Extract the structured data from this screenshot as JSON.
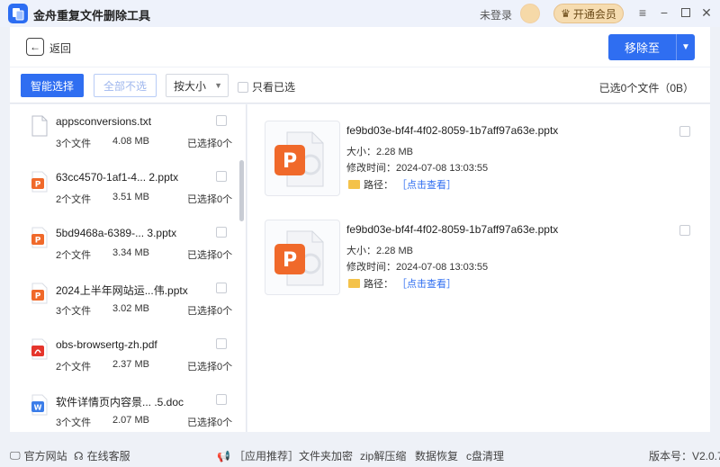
{
  "app": {
    "title": "金舟重复文件删除工具",
    "login_text": "未登录",
    "vip_label": "开通会员"
  },
  "header": {
    "back_label": "返回",
    "move_label": "移除至"
  },
  "toolbar": {
    "smart_select": "智能选择",
    "deselect_all": "全部不选",
    "sort_value": "按大小",
    "only_selected": "只看已选",
    "selected_summary": "已选0个文件（0B）"
  },
  "groups": [
    {
      "name": "appsconversions.txt",
      "count": "3个文件",
      "size": "4.08 MB",
      "selected": "已选择0个",
      "icon": "txt-file-icon"
    },
    {
      "name": "63cc4570-1af1-4... 2.pptx",
      "count": "2个文件",
      "size": "3.51 MB",
      "selected": "已选择0个",
      "icon": "pptx-file-icon"
    },
    {
      "name": "5bd9468a-6389-... 3.pptx",
      "count": "2个文件",
      "size": "3.34 MB",
      "selected": "已选择0个",
      "icon": "pptx-file-icon"
    },
    {
      "name": "2024上半年网站运...伟.pptx",
      "count": "3个文件",
      "size": "3.02 MB",
      "selected": "已选择0个",
      "icon": "pptx-file-icon"
    },
    {
      "name": "obs-browsertg-zh.pdf",
      "count": "2个文件",
      "size": "2.37 MB",
      "selected": "已选择0个",
      "icon": "pdf-file-icon"
    },
    {
      "name": "软件详情页内容景... .5.doc",
      "count": "3个文件",
      "size": "2.07 MB",
      "selected": "已选择0个",
      "icon": "doc-file-icon"
    }
  ],
  "files": [
    {
      "name": "fe9bd03e-bf4f-4f02-8059-1b7aff97a63e.pptx",
      "size": "大小：2.28 MB",
      "mtime": "修改时间：2024-07-08 13:03:55",
      "path_label": "路径：",
      "path_link": "［点击查看］"
    },
    {
      "name": "fe9bd03e-bf4f-4f02-8059-1b7aff97a63e.pptx",
      "size": "大小：2.28 MB",
      "mtime": "修改时间：2024-07-08 13:03:55",
      "path_label": "路径：",
      "path_link": "［点击查看］"
    }
  ],
  "footer": {
    "website": "官方网站",
    "service": "在线客服",
    "recommend": "［应用推荐］",
    "encrypt": "文件夹加密",
    "zip": "zip解压缩",
    "recover": "数据恢复",
    "cclean": "c盘清理",
    "version": "版本号：V2.0.7"
  },
  "colors": {
    "primary": "#2f6ef1",
    "pptx": "#f0692a",
    "pdf": "#e5352c",
    "doc": "#3b7de9",
    "vip": "#f6dcb0"
  }
}
